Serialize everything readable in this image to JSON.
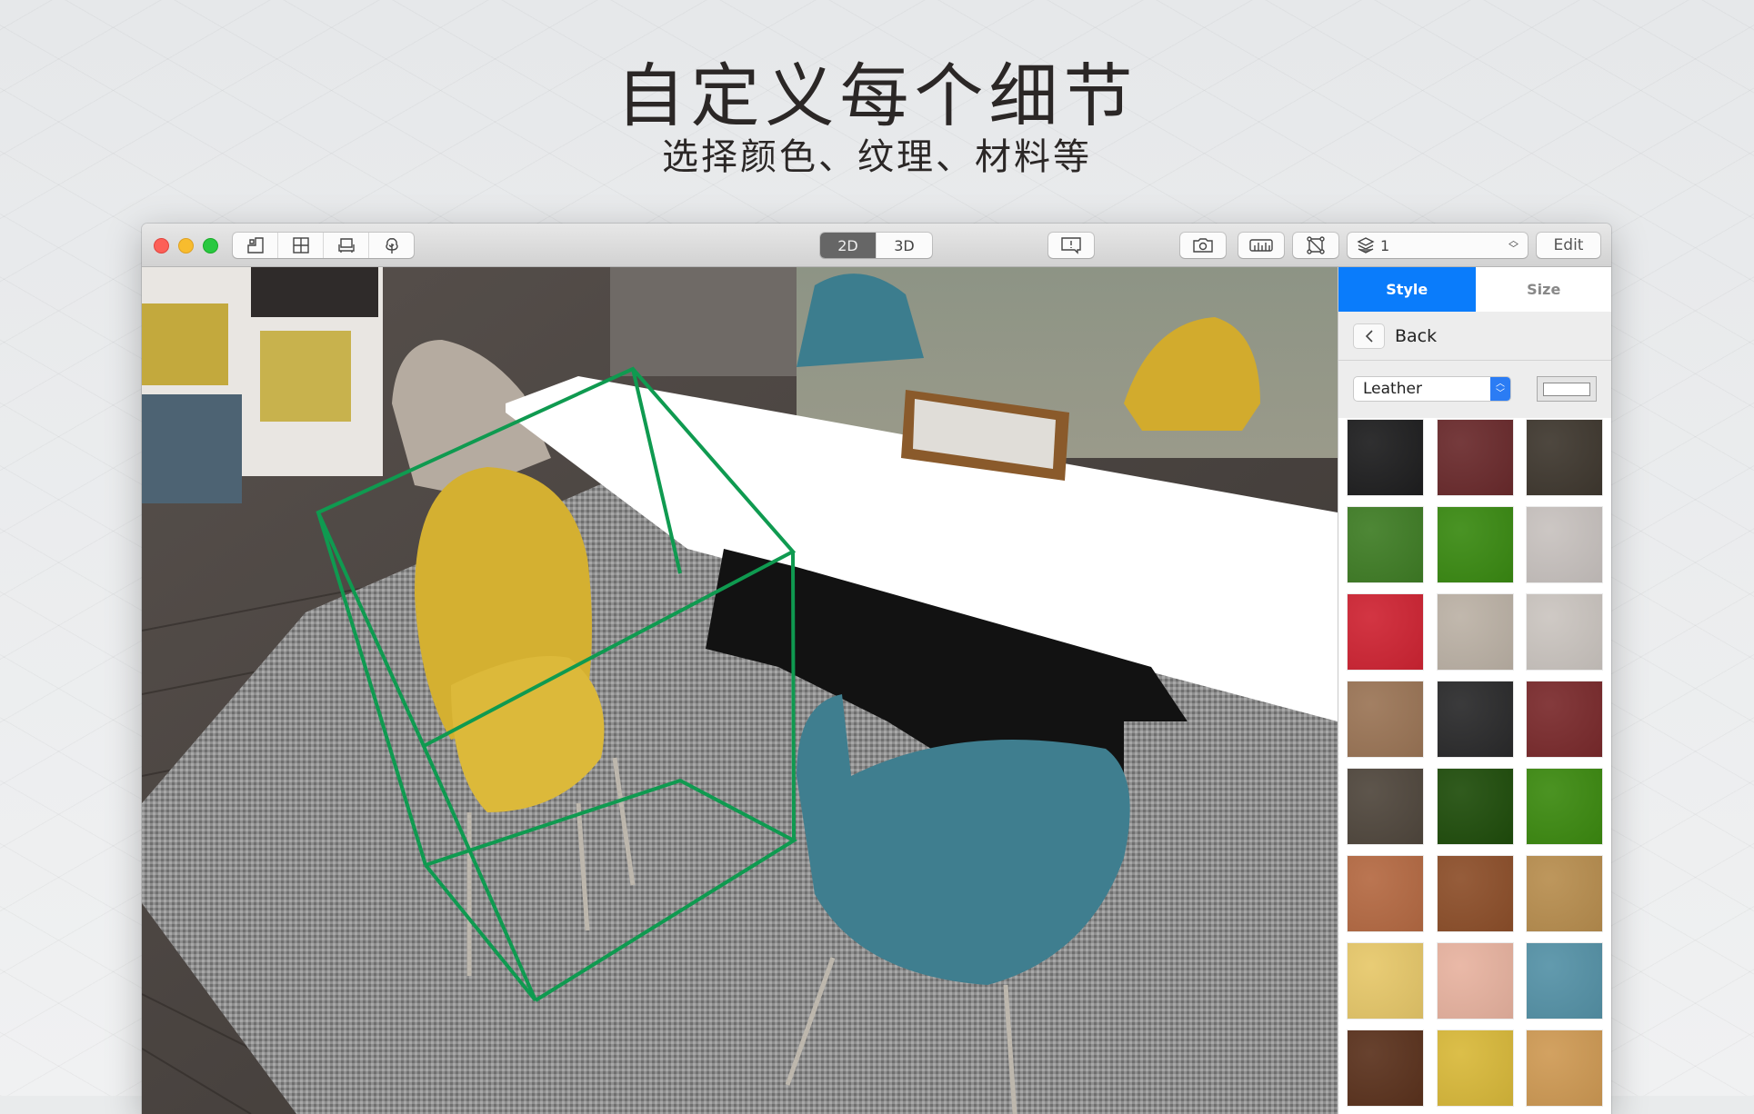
{
  "promo": {
    "headline": "自定义每个细节",
    "subline": "选择颜色、纹理、材料等"
  },
  "toolbar": {
    "window_controls": [
      "close",
      "minimize",
      "zoom"
    ],
    "tool_buttons": [
      {
        "icon": "room-plan-icon"
      },
      {
        "icon": "window-grid-icon"
      },
      {
        "icon": "furniture-icon"
      },
      {
        "icon": "tree-icon"
      }
    ],
    "view_modes": [
      {
        "label": "2D",
        "active": true
      },
      {
        "label": "3D",
        "active": false
      }
    ],
    "feedback_icon": "feedback-icon",
    "camera_icon": "camera-icon",
    "ruler_icon": "ruler-icon",
    "transform_icon": "transform-icon",
    "level": {
      "icon": "layers-icon",
      "value": "1"
    },
    "edit_label": "Edit"
  },
  "panel": {
    "tabs": [
      {
        "label": "Style",
        "active": true
      },
      {
        "label": "Size",
        "active": false
      }
    ],
    "back_label": "Back",
    "material_select": {
      "value": "Leather"
    },
    "color_well": "#ffffff",
    "swatches": [
      {
        "name": "black",
        "color": "#1e1e1f"
      },
      {
        "name": "maroon",
        "color": "#6a2a2c"
      },
      {
        "name": "dark-taupe",
        "color": "#3f382f"
      },
      {
        "name": "mottled-green",
        "color": "#3f7d25"
      },
      {
        "name": "grass-green",
        "color": "#3a8a12"
      },
      {
        "name": "light-grey",
        "color": "#c8c2bf"
      },
      {
        "name": "red",
        "color": "#cf2433"
      },
      {
        "name": "beige",
        "color": "#bcb2a6"
      },
      {
        "name": "pale-grey",
        "color": "#cbc5c0"
      },
      {
        "name": "tan",
        "color": "#9b7556"
      },
      {
        "name": "charcoal",
        "color": "#2a2a2b"
      },
      {
        "name": "burgundy",
        "color": "#7a2a2c"
      },
      {
        "name": "dark-brown-grey",
        "color": "#50473d"
      },
      {
        "name": "forest-green",
        "color": "#1f4d0b"
      },
      {
        "name": "green",
        "color": "#3c8a10"
      },
      {
        "name": "rust-mottled",
        "color": "#b56a43"
      },
      {
        "name": "saddle-brown",
        "color": "#8d4f2a"
      },
      {
        "name": "ochre-crackle",
        "color": "#b88e4f"
      },
      {
        "name": "butter-yellow",
        "color": "#e7c86a"
      },
      {
        "name": "blush",
        "color": "#e8b3a0"
      },
      {
        "name": "teal-blue",
        "color": "#5592a7"
      },
      {
        "name": "chocolate",
        "color": "#5b321d"
      },
      {
        "name": "mustard",
        "color": "#d9b93a"
      },
      {
        "name": "caramel",
        "color": "#cf9a54"
      }
    ]
  },
  "scene": {
    "selection_color": "#0f9a50",
    "description": "3D dining room with selected yellow chair"
  }
}
